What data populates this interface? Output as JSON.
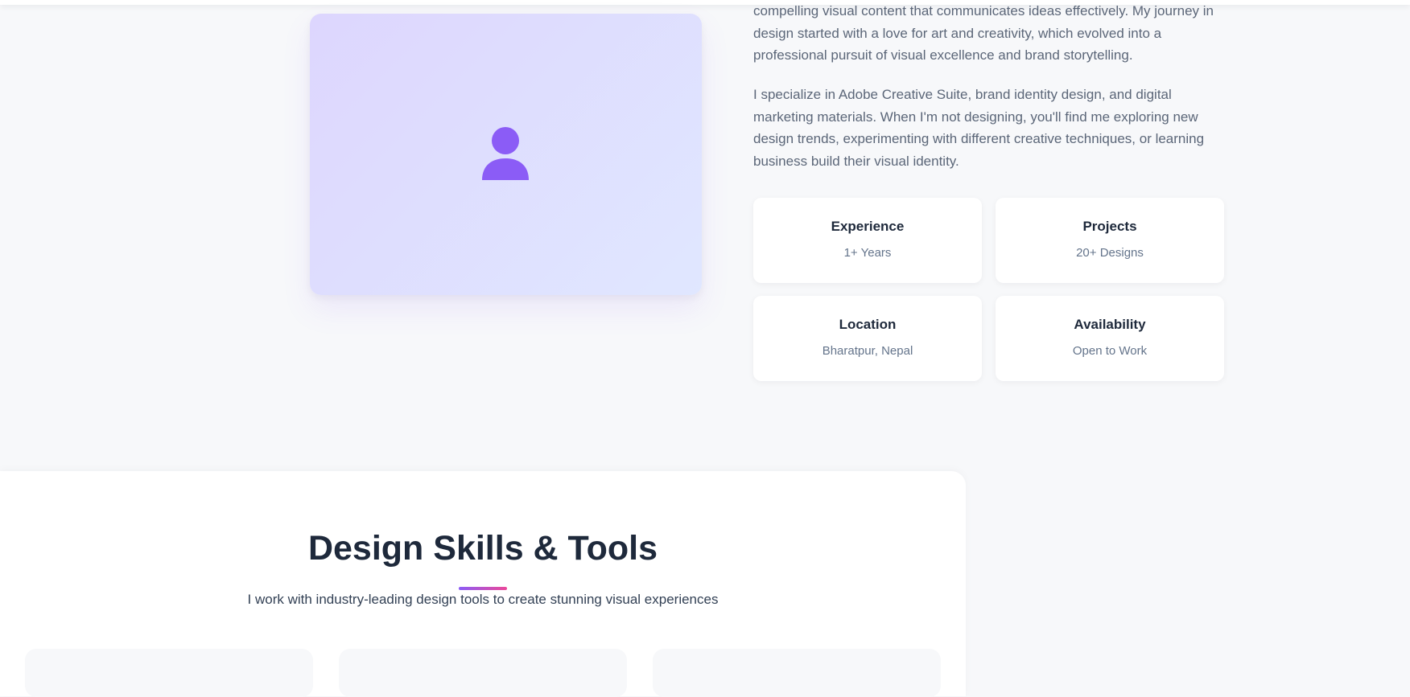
{
  "about": {
    "paragraph_1": "compelling visual content that communicates ideas effectively. My journey in design started with a love for art and creativity, which evolved into a professional pursuit of visual excellence and brand storytelling.",
    "paragraph_2": "I specialize in Adobe Creative Suite, brand identity design, and digital marketing materials. When I'm not designing, you'll find me exploring new design trends, experimenting with different creative techniques, or learning business build their visual identity."
  },
  "stats": [
    {
      "title": "Experience",
      "value": "1+ Years"
    },
    {
      "title": "Projects",
      "value": "20+ Designs"
    },
    {
      "title": "Location",
      "value": "Bharatpur, Nepal"
    },
    {
      "title": "Availability",
      "value": "Open to Work"
    }
  ],
  "skills": {
    "title": "Design Skills & Tools",
    "subtitle": "I work with industry-leading design tools to create stunning visual experiences"
  },
  "colors": {
    "accent_purple": "#8b5cf6",
    "accent_pink": "#ec4899",
    "page_bg": "#f7f8fa",
    "heading": "#1e293b",
    "body_text": "#5b6678"
  },
  "icons": {
    "profile_placeholder": "user-icon"
  }
}
